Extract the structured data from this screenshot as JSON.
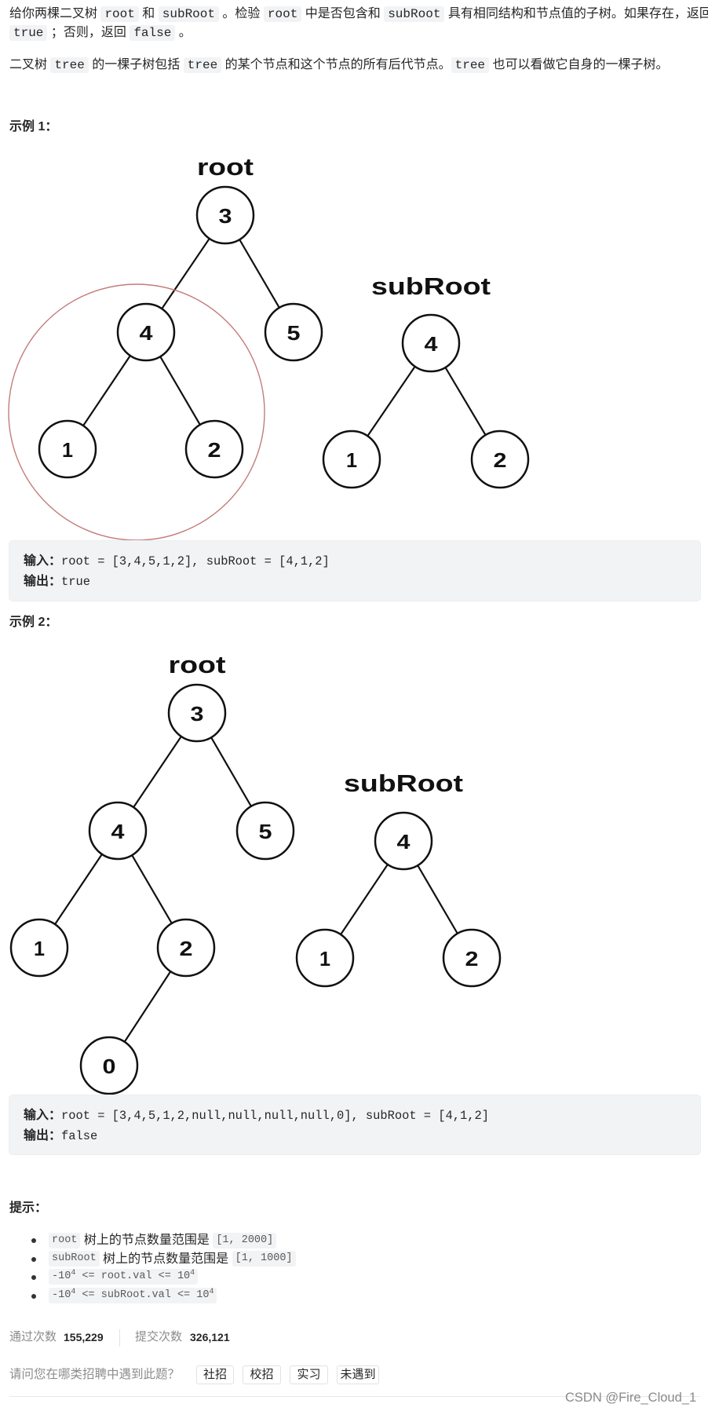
{
  "description": {
    "p1_line1": [
      {
        "type": "text",
        "value": "给你两棵二叉树 "
      },
      {
        "type": "code",
        "value": "root"
      },
      {
        "type": "text",
        "value": " 和 "
      },
      {
        "type": "code",
        "value": "subRoot"
      },
      {
        "type": "text",
        "value": " 。检验 "
      },
      {
        "type": "code",
        "value": "root"
      },
      {
        "type": "text",
        "value": " 中是否包含和 "
      },
      {
        "type": "code",
        "value": "subRoot"
      },
      {
        "type": "text",
        "value": " 具有相同结构和节点值的子树。如果存在，返回"
      }
    ],
    "p1_line2": [
      {
        "type": "code",
        "value": "true"
      },
      {
        "type": "text",
        "value": " ；否则，返回 "
      },
      {
        "type": "code",
        "value": "false"
      },
      {
        "type": "text",
        "value": " 。"
      }
    ],
    "p2": [
      {
        "type": "text",
        "value": "二叉树 "
      },
      {
        "type": "code",
        "value": "tree"
      },
      {
        "type": "text",
        "value": " 的一棵子树包括 "
      },
      {
        "type": "code",
        "value": "tree"
      },
      {
        "type": "text",
        "value": " 的某个节点和这个节点的所有后代节点。"
      },
      {
        "type": "code",
        "value": "tree"
      },
      {
        "type": "text",
        "value": " 也可以看做它自身的一棵子树。"
      }
    ]
  },
  "examples": [
    {
      "heading": "示例 1：",
      "diagram": {
        "root_label": "root",
        "root_nodes": [
          "3",
          "4",
          "5",
          "1",
          "2"
        ],
        "subroot_label": "subRoot",
        "subroot_nodes": [
          "4",
          "1",
          "2"
        ],
        "highlight_color": "#c47b7b"
      },
      "io": {
        "input_label": "输入：",
        "input_value": "root = [3,4,5,1,2], subRoot = [4,1,2]",
        "output_label": "输出：",
        "output_value": "true"
      }
    },
    {
      "heading": "示例 2：",
      "diagram": {
        "root_label": "root",
        "root_nodes": [
          "3",
          "4",
          "5",
          "1",
          "2",
          "0"
        ],
        "subroot_label": "subRoot",
        "subroot_nodes": [
          "4",
          "1",
          "2"
        ]
      },
      "io": {
        "input_label": "输入：",
        "input_value": "root = [3,4,5,1,2,null,null,null,null,0], subRoot = [4,1,2]",
        "output_label": "输出：",
        "output_value": "false"
      }
    }
  ],
  "hints": {
    "title": "提示：",
    "items": [
      {
        "segments": [
          {
            "type": "code",
            "value": "root"
          },
          {
            "type": "text",
            "value": " 树上的节点数量范围是 "
          },
          {
            "type": "code",
            "value": "[1, 2000]"
          }
        ]
      },
      {
        "segments": [
          {
            "type": "code",
            "value": "subRoot"
          },
          {
            "type": "text",
            "value": " 树上的节点数量范围是 "
          },
          {
            "type": "code",
            "value": "[1, 1000]"
          }
        ]
      },
      {
        "expr": {
          "lhs_base": "-10",
          "lhs_exp": "4",
          "middle": " <= root.val <= ",
          "rhs_base": "10",
          "rhs_exp": "4"
        }
      },
      {
        "expr": {
          "lhs_base": "-10",
          "lhs_exp": "4",
          "middle": " <= subRoot.val <= ",
          "rhs_base": "10",
          "rhs_exp": "4"
        }
      }
    ]
  },
  "stats": {
    "accepted_label": "通过次数",
    "accepted_value": "155,229",
    "submissions_label": "提交次数",
    "submissions_value": "326,121"
  },
  "survey": {
    "question": "请问您在哪类招聘中遇到此题？",
    "options": [
      "社招",
      "校招",
      "实习",
      "未遇到"
    ]
  },
  "watermark": "CSDN @Fire_Cloud_1"
}
